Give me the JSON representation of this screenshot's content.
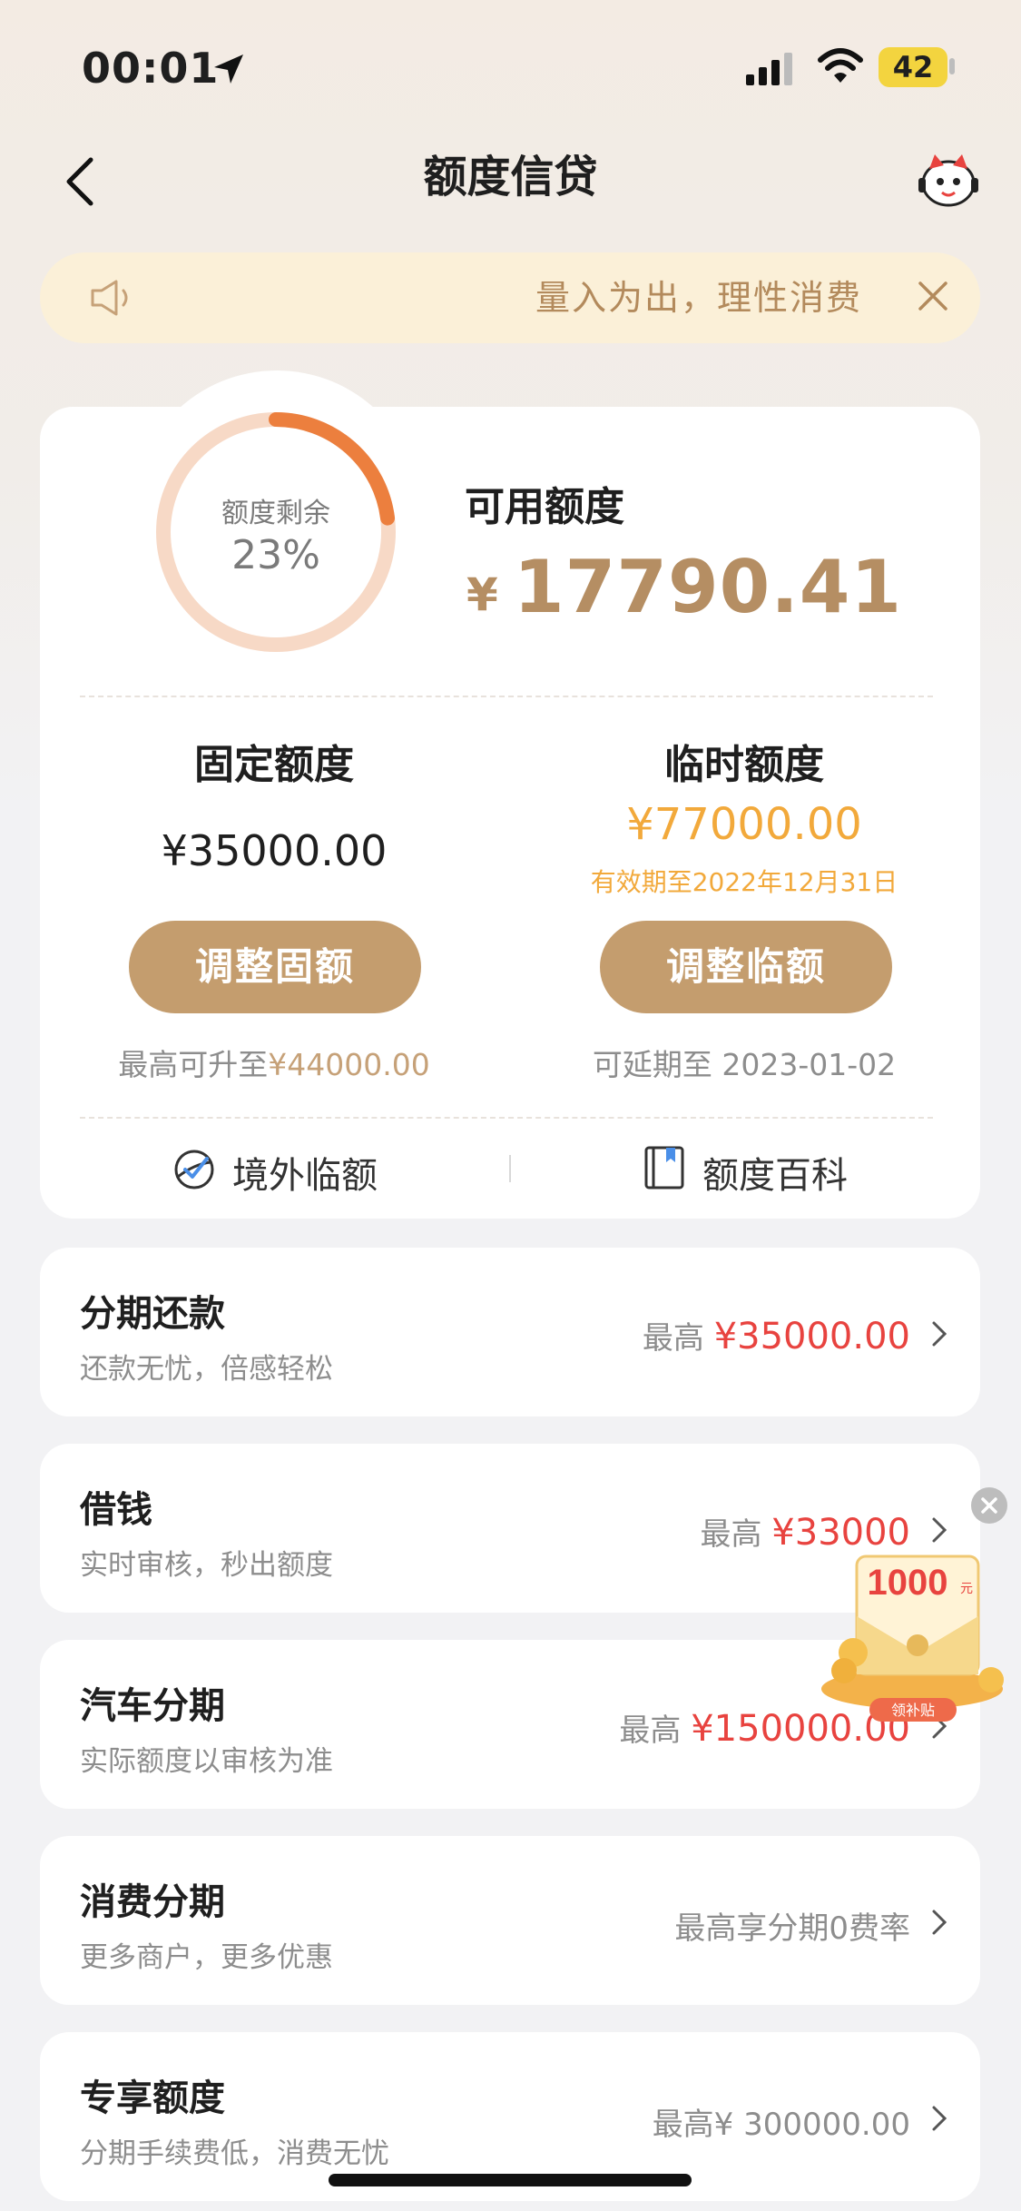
{
  "status_bar": {
    "time": "00:01",
    "battery": "42"
  },
  "nav": {
    "title": "额度信贷"
  },
  "notice": {
    "text": "量入为出，理性消费"
  },
  "credit": {
    "ring_label": "额度剩余",
    "ring_percent": "23%",
    "ring_fraction": 0.23,
    "available_label": "可用额度",
    "available_currency": "¥",
    "available_value": "17790.41",
    "fixed": {
      "title": "固定额度",
      "value": "¥35000.00",
      "button": "调整固额",
      "note_prefix": "最高可升至",
      "note_value": "¥44000.00"
    },
    "temp": {
      "title": "临时额度",
      "value": "¥77000.00",
      "expiry": "有效期至2022年12月31日",
      "button": "调整临额",
      "note": "可延期至 2023-01-02"
    },
    "links": {
      "overseas": "境外临额",
      "wiki": "额度百科"
    }
  },
  "list": [
    {
      "title": "分期还款",
      "subtitle": "还款无忧，倍感轻松",
      "right_prefix": "最高",
      "right_value": "¥35000.00"
    },
    {
      "title": "借钱",
      "subtitle": "实时审核，秒出额度",
      "right_prefix": "最高",
      "right_value": "¥33000"
    },
    {
      "title": "汽车分期",
      "subtitle": "实际额度以审核为准",
      "right_prefix": "最高",
      "right_value": "¥150000.00"
    },
    {
      "title": "消费分期",
      "subtitle": "更多商户，更多优惠",
      "right_text": "最高享分期0费率"
    },
    {
      "title": "专享额度",
      "subtitle": "分期手续费低，消费无忧",
      "right_text": "最高¥ 300000.00"
    }
  ],
  "floating_coupon": {
    "amount": "1000",
    "unit": "元",
    "label": "领补贴"
  },
  "colors": {
    "accent": "#c49d6e",
    "orange": "#f2a93b",
    "red": "#e8433f",
    "ring": "#ec7f3e",
    "ring_bg": "#f7d9c6"
  }
}
